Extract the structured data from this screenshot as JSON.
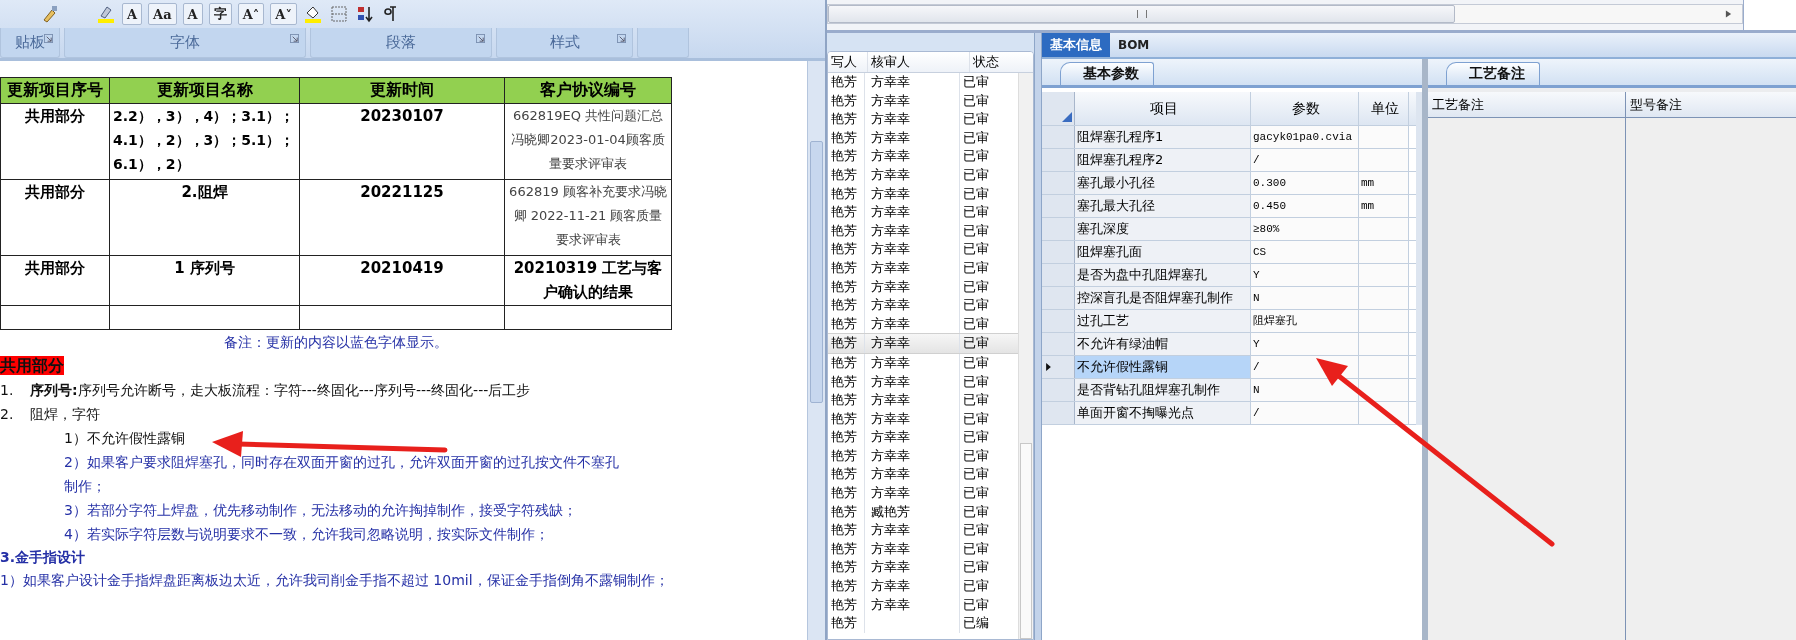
{
  "ribbon": {
    "glyph_buttons": [
      "A",
      "Aa",
      "A",
      "字",
      "A˄",
      "A˅"
    ],
    "groups": [
      {
        "label": "贴板"
      },
      {
        "label": "字体"
      },
      {
        "label": "段落"
      },
      {
        "label": "样式"
      }
    ]
  },
  "document": {
    "table": {
      "columns": [
        "更新项目序号",
        "更新项目名称",
        "更新时间",
        "客户协议编号"
      ],
      "rows": [
        {
          "cells": [
            "共用部分",
            "2.2），3），4）；3.1）；4.1），2），3）；5.1）；6.1），2）",
            "20230107",
            "662819EQ 共性问题汇总冯晓卿2023-01-04顾客质量要求评审表"
          ],
          "agreement_bold": false
        },
        {
          "cells": [
            "共用部分",
            "2.阻焊",
            "20221125",
            "662819 顾客补充要求冯晓卿 2022-11-21 顾客质量要求评审表"
          ],
          "agreement_bold": false
        },
        {
          "cells": [
            "共用部分",
            "1 序列号",
            "20210419",
            "20210319 工艺与客户确认的结果"
          ],
          "agreement_bold": true
        }
      ]
    },
    "note": "备注：更新的内容以蓝色字体显示。",
    "section_heading": "共用部分",
    "items": [
      {
        "number": "1.",
        "text": "**序列号:**序列号允许断号，走大板流程：字符---终固化---序列号---终固化---后工步"
      },
      {
        "number": "2.",
        "text": "阻焊，字符"
      }
    ],
    "sub_items": [
      {
        "text": "1）不允许假性露铜",
        "updated": false
      },
      {
        "text": "2）如果客户要求阻焊塞孔，同时存在双面开窗的过孔，允许双面开窗的过孔按文件不塞孔制作；",
        "updated": true
      },
      {
        "text": "3）若部分字符上焊盘，优先移动制作，无法移动的允许掏掉制作，接受字符残缺；",
        "updated": true
      },
      {
        "text": "4）若实际字符层数与说明要求不一致，允许我司忽略说明，按实际文件制作；",
        "updated": true
      }
    ],
    "heading_3": "3.金手指设计",
    "paragraph": "1）如果客户设计金手指焊盘距离板边太近，允许我司削金手指不超过 10mil，保证金手指倒角不露铜制作；"
  },
  "review_list": {
    "columns": [
      "写人",
      "核审人",
      "状态"
    ],
    "rows": [
      {
        "author": "艳芳",
        "reviewer": "方幸幸",
        "status": "已审",
        "selected": false
      },
      {
        "author": "艳芳",
        "reviewer": "方幸幸",
        "status": "已审",
        "selected": false
      },
      {
        "author": "艳芳",
        "reviewer": "方幸幸",
        "status": "已审",
        "selected": false
      },
      {
        "author": "艳芳",
        "reviewer": "方幸幸",
        "status": "已审",
        "selected": false
      },
      {
        "author": "艳芳",
        "reviewer": "方幸幸",
        "status": "已审",
        "selected": false
      },
      {
        "author": "艳芳",
        "reviewer": "方幸幸",
        "status": "已审",
        "selected": false
      },
      {
        "author": "艳芳",
        "reviewer": "方幸幸",
        "status": "已审",
        "selected": false
      },
      {
        "author": "艳芳",
        "reviewer": "方幸幸",
        "status": "已审",
        "selected": false
      },
      {
        "author": "艳芳",
        "reviewer": "方幸幸",
        "status": "已审",
        "selected": false
      },
      {
        "author": "艳芳",
        "reviewer": "方幸幸",
        "status": "已审",
        "selected": false
      },
      {
        "author": "艳芳",
        "reviewer": "方幸幸",
        "status": "已审",
        "selected": false
      },
      {
        "author": "艳芳",
        "reviewer": "方幸幸",
        "status": "已审",
        "selected": false
      },
      {
        "author": "艳芳",
        "reviewer": "方幸幸",
        "status": "已审",
        "selected": false
      },
      {
        "author": "艳芳",
        "reviewer": "方幸幸",
        "status": "已审",
        "selected": false
      },
      {
        "author": "艳芳",
        "reviewer": "方幸幸",
        "status": "已审",
        "selected": true
      },
      {
        "author": "艳芳",
        "reviewer": "方幸幸",
        "status": "已审",
        "selected": false
      },
      {
        "author": "艳芳",
        "reviewer": "方幸幸",
        "status": "已审",
        "selected": false
      },
      {
        "author": "艳芳",
        "reviewer": "方幸幸",
        "status": "已审",
        "selected": false
      },
      {
        "author": "艳芳",
        "reviewer": "方幸幸",
        "status": "已审",
        "selected": false
      },
      {
        "author": "艳芳",
        "reviewer": "方幸幸",
        "status": "已审",
        "selected": false
      },
      {
        "author": "艳芳",
        "reviewer": "方幸幸",
        "status": "已审",
        "selected": false
      },
      {
        "author": "艳芳",
        "reviewer": "方幸幸",
        "status": "已审",
        "selected": false
      },
      {
        "author": "艳芳",
        "reviewer": "方幸幸",
        "status": "已审",
        "selected": false
      },
      {
        "author": "艳芳",
        "reviewer": "臧艳芳",
        "status": "已审",
        "selected": false
      },
      {
        "author": "艳芳",
        "reviewer": "方幸幸",
        "status": "已审",
        "selected": false
      },
      {
        "author": "艳芳",
        "reviewer": "方幸幸",
        "status": "已审",
        "selected": false
      },
      {
        "author": "艳芳",
        "reviewer": "方幸幸",
        "status": "已审",
        "selected": false
      },
      {
        "author": "艳芳",
        "reviewer": "方幸幸",
        "status": "已审",
        "selected": false
      },
      {
        "author": "艳芳",
        "reviewer": "方幸幸",
        "status": "已审",
        "selected": false
      },
      {
        "author": "艳芳",
        "status": "已编",
        "selected": false
      }
    ]
  },
  "detail_tabs": [
    {
      "label": "基本信息",
      "selected": true
    },
    {
      "label": "BOM",
      "selected": false
    }
  ],
  "params_panel": {
    "tab": "基本参数",
    "columns": [
      "项目",
      "参数",
      "单位"
    ],
    "rows": [
      {
        "item": "阻焊塞孔程序1",
        "value": "gacyk01pa0.cvia",
        "selected": false
      },
      {
        "item": "阻焊塞孔程序2",
        "value": "/",
        "selected": false
      },
      {
        "item": "塞孔最小孔径",
        "value": "0.300",
        "unit": "mm",
        "selected": false
      },
      {
        "item": "塞孔最大孔径",
        "value": "0.450",
        "unit": "mm",
        "selected": false
      },
      {
        "item": "塞孔深度",
        "value": "≥80%",
        "selected": false
      },
      {
        "item": "阻焊塞孔面",
        "value": "CS",
        "selected": false
      },
      {
        "item": "是否为盘中孔阻焊塞孔",
        "value": "Y",
        "selected": false
      },
      {
        "item": "控深盲孔是否阻焊塞孔制作",
        "value": "N",
        "selected": false
      },
      {
        "item": "过孔工艺",
        "value": "阻焊塞孔",
        "selected": false
      },
      {
        "item": "不允许有绿油帽",
        "value": "Y",
        "selected": false
      },
      {
        "item": "不允许假性露铜",
        "value": "/",
        "selected": true
      },
      {
        "item": "是否背钻孔阻焊塞孔制作",
        "value": "N",
        "selected": false
      },
      {
        "item": "单面开窗不掏曝光点",
        "value": "/",
        "selected": false
      }
    ]
  },
  "remarks_panel": {
    "tab": "工艺备注",
    "columns": [
      "工艺备注",
      "型号备注"
    ]
  }
}
